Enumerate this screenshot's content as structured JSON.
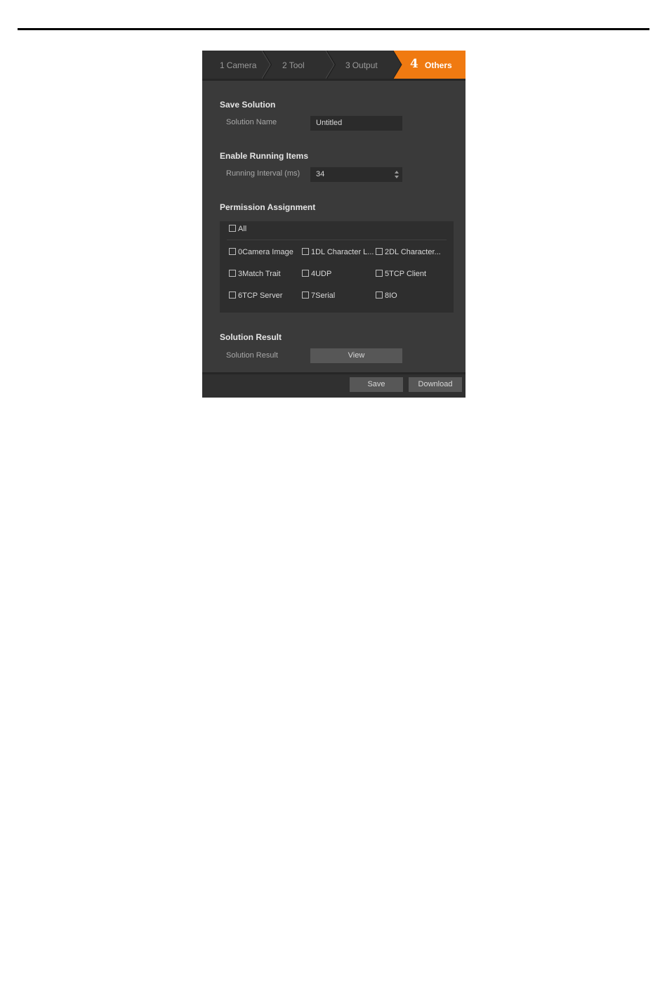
{
  "steps": [
    {
      "num": "1",
      "label": "Camera"
    },
    {
      "num": "2",
      "label": "Tool"
    },
    {
      "num": "3",
      "label": "Output"
    },
    {
      "num": "4",
      "label": "Others"
    }
  ],
  "save_solution": {
    "title": "Save Solution",
    "name_label": "Solution Name",
    "name_value": "Untitled"
  },
  "running": {
    "title": "Enable Running Items",
    "interval_label": "Running Interval (ms)",
    "interval_value": "34"
  },
  "permission": {
    "title": "Permission Assignment",
    "all_label": "All",
    "items": [
      "0Camera Image",
      "1DL Character L...",
      "2DL Character...",
      "3Match Trait",
      "4UDP",
      "5TCP Client",
      "6TCP Server",
      "7Serial",
      "8IO"
    ]
  },
  "result": {
    "title": "Solution Result",
    "label": "Solution Result",
    "view_label": "View"
  },
  "footer": {
    "save_label": "Save",
    "download_label": "Download"
  },
  "colors": {
    "accent": "#f07a11",
    "panel": "#3a3a3a"
  }
}
